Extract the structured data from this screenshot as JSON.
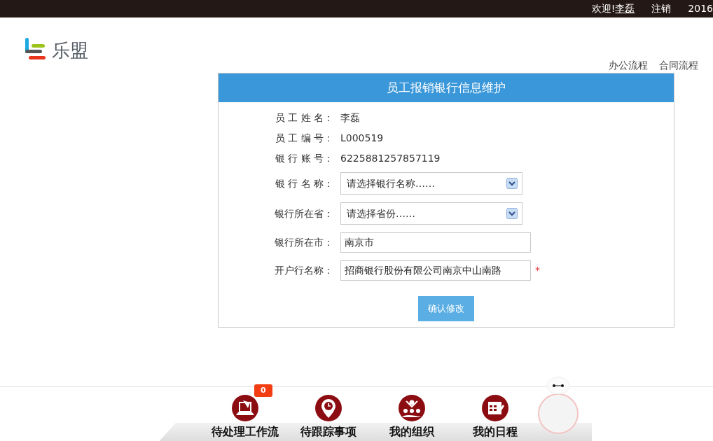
{
  "top_bar": {
    "greeting": "欢迎!",
    "user": "李磊",
    "logout": "注销",
    "date": "2016"
  },
  "header": {
    "logo_text": "乐盟",
    "nav": [
      "办公流程",
      "合同流程"
    ]
  },
  "form": {
    "title": "员工报销银行信息维护",
    "fields": [
      {
        "kind": "text",
        "label": "员 工 姓 名：",
        "value": "李磊"
      },
      {
        "kind": "text",
        "label": "员 工 编 号：",
        "value": "L000519"
      },
      {
        "kind": "text",
        "label": "银 行 账 号：",
        "value": "6225881257857119"
      },
      {
        "kind": "select",
        "label": "银 行 名 称：",
        "value": "请选择银行名称……"
      },
      {
        "kind": "select",
        "label": "银行所在省：",
        "value": "请选择省份……"
      },
      {
        "kind": "input",
        "label": "银行所在市：",
        "value": "南京市"
      },
      {
        "kind": "input",
        "label": "开户行名称：",
        "value": "招商银行股份有限公司南京中山南路",
        "required_mark": "*"
      }
    ],
    "submit": "确认修改"
  },
  "dock": {
    "items": [
      {
        "kind": "workflow",
        "label": "待处理工作流",
        "badge": "0"
      },
      {
        "kind": "tracking",
        "label": "待跟踪事项"
      },
      {
        "kind": "organization",
        "label": "我的组织"
      },
      {
        "kind": "schedule",
        "label": "我的日程"
      }
    ]
  }
}
